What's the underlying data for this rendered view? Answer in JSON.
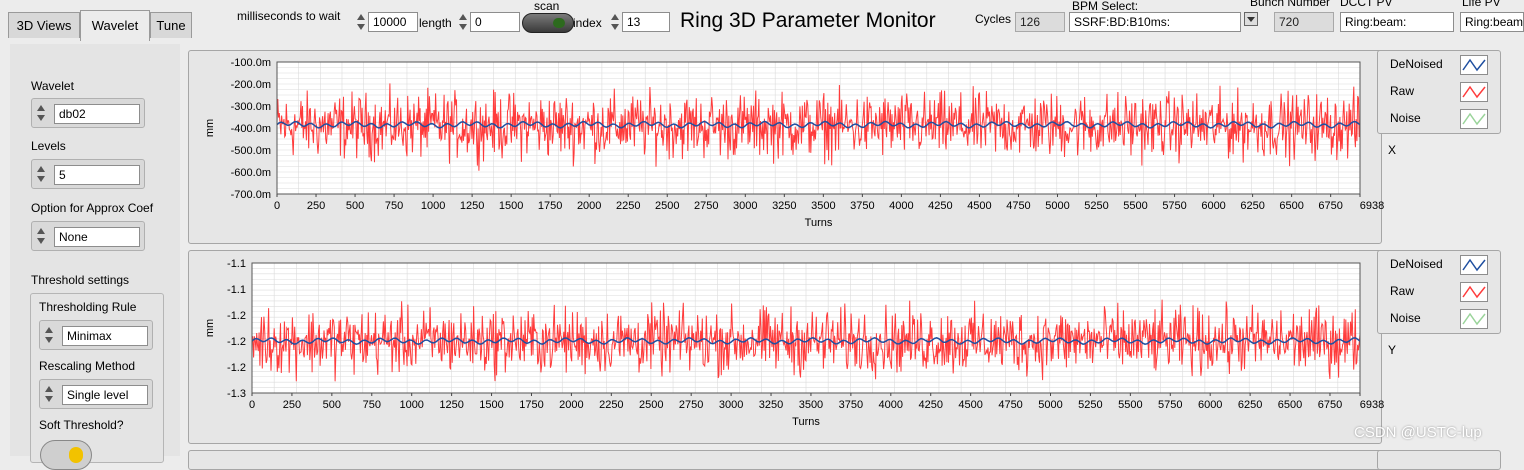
{
  "tabs": [
    "3D Views",
    "Wavelet",
    "Tune"
  ],
  "active_tab": "Wavelet",
  "toolbar": {
    "ms_label": "milliseconds to wait",
    "ms_value": "10000",
    "length_label": "length",
    "length_value": "0",
    "scan_label": "scan",
    "index_label": "index",
    "index_value": "13",
    "app_title": "Ring 3D Parameter Monitor",
    "cycles_label": "Cycles",
    "cycles_value": "126",
    "bpm_label": "BPM Select:",
    "bpm_value": "SSRF:BD:B10ms:",
    "bunch_label": "Bunch Number",
    "bunch_value": "720",
    "dcct_label": "DCCT PV",
    "dcct_value": "Ring:beam:",
    "life_label": "Life PV",
    "life_value": "Ring:beam"
  },
  "left_panel": {
    "wavelet_label": "Wavelet",
    "wavelet_value": "db02",
    "levels_label": "Levels",
    "levels_value": "5",
    "approx_label": "Option for Approx Coef",
    "approx_value": "None",
    "threshold_label": "Threshold settings",
    "rule_label": "Thresholding Rule",
    "rule_value": "Minimax",
    "rescale_label": "Rescaling Method",
    "rescale_value": "Single level",
    "soft_label": "Soft Threshold?"
  },
  "legend": {
    "denoised": "DeNoised",
    "raw": "Raw",
    "noise": "Noise"
  },
  "colors": {
    "raw": "#ff3b3b",
    "denoised": "#1f4fa0",
    "noise": "#9ad49a",
    "plot_bg": "#ffffff",
    "grid": "#dcdcdc"
  },
  "watermark": "CSDN @USTC-lup",
  "chart_data": [
    {
      "type": "line",
      "legend_tag": "X",
      "xlabel": "Turns",
      "ylabel": "mm",
      "xlim": [
        0,
        6938
      ],
      "ylim": [
        -700,
        -100
      ],
      "x_ticks": [
        0,
        250,
        500,
        750,
        1000,
        1250,
        1500,
        1750,
        2000,
        2250,
        2500,
        2750,
        3000,
        3250,
        3500,
        3750,
        4000,
        4250,
        4500,
        4750,
        5000,
        5250,
        5500,
        5750,
        6000,
        6250,
        6500,
        6750,
        6938
      ],
      "y_tick_labels": [
        "-100.0m",
        "-200.0m",
        "-300.0m",
        "-400.0m",
        "-500.0m",
        "-600.0m",
        "-700.0m"
      ],
      "y_tick_values": [
        -100,
        -200,
        -300,
        -400,
        -500,
        -600,
        -700
      ],
      "series": [
        {
          "name": "Raw",
          "mean": -390,
          "band": [
            -600,
            -190
          ]
        },
        {
          "name": "DeNoised",
          "mean": -385,
          "band": [
            -400,
            -370
          ]
        }
      ]
    },
    {
      "type": "line",
      "legend_tag": "Y",
      "xlabel": "Turns",
      "ylabel": "mm",
      "xlim": [
        0,
        6938
      ],
      "ylim": [
        -1.3,
        -1.1
      ],
      "x_ticks": [
        0,
        250,
        500,
        750,
        1000,
        1250,
        1500,
        1750,
        2000,
        2250,
        2500,
        2750,
        3000,
        3250,
        3500,
        3750,
        4000,
        4250,
        4500,
        4750,
        5000,
        5250,
        5500,
        5750,
        6000,
        6250,
        6500,
        6750,
        6938
      ],
      "y_tick_labels": [
        "-1.1",
        "-1.1",
        "-1.2",
        "-1.2",
        "-1.2",
        "-1.3"
      ],
      "y_tick_values": [
        -1.1,
        -1.14,
        -1.18,
        -1.22,
        -1.26,
        -1.3
      ],
      "series": [
        {
          "name": "Raw",
          "mean": -1.22,
          "band": [
            -1.28,
            -1.14
          ]
        },
        {
          "name": "DeNoised",
          "mean": -1.22,
          "band": [
            -1.225,
            -1.215
          ]
        }
      ]
    }
  ]
}
